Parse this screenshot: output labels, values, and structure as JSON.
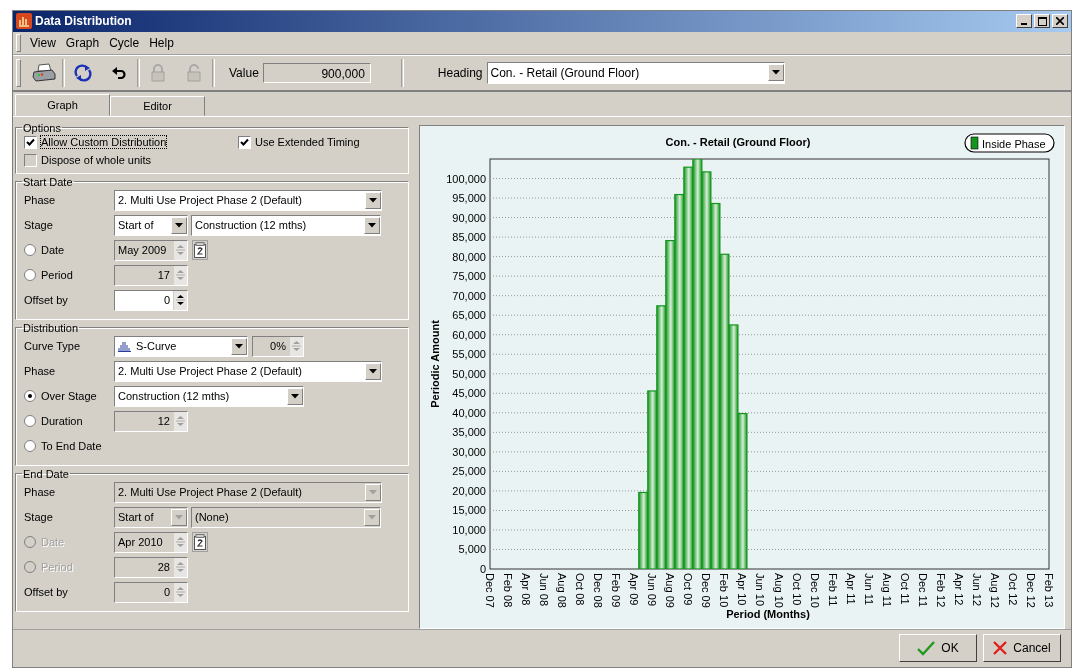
{
  "window": {
    "title": "Data Distribution"
  },
  "menu": [
    {
      "label": "View"
    },
    {
      "label": "Graph"
    },
    {
      "label": "Cycle"
    },
    {
      "label": "Help"
    }
  ],
  "toolbar": {
    "buttons": [
      {
        "kind": "print",
        "disabled": false
      },
      {
        "kind": "refresh",
        "disabled": false
      },
      {
        "kind": "undo",
        "disabled": false
      },
      {
        "kind": "lock",
        "disabled": true
      },
      {
        "kind": "unlock",
        "disabled": true
      }
    ],
    "value_label": "Value",
    "value": "900,000",
    "heading_label": "Heading",
    "heading": "Con. - Retail (Ground Floor)"
  },
  "tabs": [
    {
      "label": "Graph",
      "selected": true
    },
    {
      "label": "Editor",
      "selected": false
    }
  ],
  "options": {
    "title": "Options",
    "checks": [
      {
        "label": "Allow Custom Distribution",
        "checked": true,
        "disabled": false
      },
      {
        "label": "Use Extended Timing",
        "checked": true,
        "disabled": false
      },
      {
        "label": "Dispose of whole units",
        "checked": false,
        "disabled": true
      }
    ]
  },
  "sections": [
    {
      "title": "Start Date",
      "rows": [
        {
          "kind": "combo",
          "label": "Phase",
          "value": "2. Multi Use Project Phase 2  (Default)",
          "disabled": false
        },
        {
          "kind": "stage",
          "label": "Stage",
          "qualifier": "Start of",
          "value": "Construction (12 mths)",
          "disabled": false
        },
        {
          "kind": "date",
          "label": "Date",
          "selected": false,
          "label_disabled": false,
          "value": "May 2009",
          "disabled": true
        },
        {
          "kind": "spin",
          "label": "Period",
          "selected": false,
          "label_disabled": false,
          "value": "17",
          "disabled": true
        },
        {
          "kind": "spin",
          "label": "Offset by",
          "value": "0",
          "disabled": false
        }
      ]
    },
    {
      "title": "Distribution",
      "rows": [
        {
          "kind": "curve",
          "label": "Curve Type",
          "value": "S-Curve",
          "percent": "0%",
          "disabled": false,
          "percent_disabled": true
        },
        {
          "kind": "combo",
          "label": "Phase",
          "value": "2. Multi Use Project Phase 2  (Default)",
          "disabled": false
        },
        {
          "kind": "short-combo",
          "label": "Over Stage",
          "selected": true,
          "label_disabled": false,
          "value": "Construction (12 mths)",
          "disabled": false
        },
        {
          "kind": "spin",
          "label": "Duration",
          "selected": false,
          "label_disabled": false,
          "value": "12",
          "disabled": true
        },
        {
          "kind": "none",
          "label": "To End Date",
          "selected": false,
          "label_disabled": false
        }
      ]
    },
    {
      "title": "End Date",
      "rows": [
        {
          "kind": "combo",
          "label": "Phase",
          "value": "2. Multi Use Project Phase 2  (Default)",
          "disabled": true
        },
        {
          "kind": "stage",
          "label": "Stage",
          "qualifier": "Start of",
          "value": "(None)",
          "disabled": true
        },
        {
          "kind": "date",
          "label": "Date",
          "selected": false,
          "label_disabled": true,
          "value": "Apr 2010",
          "disabled": true
        },
        {
          "kind": "spin",
          "label": "Period",
          "selected": false,
          "label_disabled": true,
          "value": "28",
          "disabled": true
        },
        {
          "kind": "spin",
          "label": "Offset by",
          "value": "0",
          "disabled": true
        }
      ]
    }
  ],
  "graph": {
    "chart_data": {
      "type": "bar",
      "title": "Con. - Retail (Ground Floor)",
      "xlabel": "Period (Months)",
      "ylabel": "Periodic Amount",
      "categories": [
        "Dec 07",
        null,
        "Feb 08",
        null,
        "Apr 08",
        null,
        "Jun 08",
        null,
        "Aug 08",
        null,
        "Oct 08",
        null,
        "Dec 08",
        null,
        "Feb 09",
        null,
        "Apr 09",
        null,
        "Jun 09",
        null,
        "Aug 09",
        null,
        "Oct 09",
        null,
        "Dec 09",
        null,
        "Feb 10",
        null,
        "Apr 10",
        null,
        "Jun 10",
        null,
        "Aug 10",
        null,
        "Oct 10",
        null,
        "Dec 10",
        null,
        "Feb 11",
        null,
        "Apr 11",
        null,
        "Jun 11",
        null,
        "Aug 11",
        null,
        "Oct 11",
        null,
        "Dec 11",
        null,
        "Feb 12",
        null,
        "Apr 12",
        null,
        "Jun 12",
        null,
        "Aug 12",
        null,
        "Oct 12",
        null,
        "Dec 12",
        null,
        "Feb 13"
      ],
      "series": [
        {
          "name": "Inside Phase",
          "color": "#14961e",
          "values": [
            null,
            null,
            null,
            null,
            null,
            null,
            null,
            null,
            null,
            null,
            null,
            null,
            null,
            null,
            null,
            null,
            null,
            19600,
            45600,
            67400,
            84100,
            95900,
            102900,
            105000,
            101700,
            93600,
            80600,
            62500,
            39800,
            null,
            null,
            null,
            null,
            null,
            null,
            null,
            null,
            null,
            null,
            null,
            null,
            null,
            null,
            null,
            null,
            null,
            null,
            null,
            null,
            null,
            null,
            null,
            null,
            null,
            null,
            null,
            null,
            null,
            null,
            null,
            null,
            null,
            null
          ]
        }
      ],
      "ylim": [
        0,
        105000
      ],
      "grid": true,
      "yticks": [
        0,
        {
          "value": 5000,
          "label": "5,000"
        },
        {
          "value": 10000,
          "label": "10,000"
        },
        {
          "value": 15000,
          "label": "15,000"
        },
        {
          "value": 20000,
          "label": "20,000"
        },
        {
          "value": 25000,
          "label": "25,000"
        },
        {
          "value": 30000,
          "label": "30,000"
        },
        {
          "value": 35000,
          "label": "35,000"
        },
        {
          "value": 40000,
          "label": "40,000"
        },
        {
          "value": 45000,
          "label": "45,000"
        },
        {
          "value": 50000,
          "label": "50,000"
        },
        {
          "value": 55000,
          "label": "55,000"
        },
        {
          "value": 60000,
          "label": "60,000"
        },
        {
          "value": 65000,
          "label": "65,000"
        },
        {
          "value": 70000,
          "label": "70,000"
        },
        {
          "value": 75000,
          "label": "75,000"
        },
        {
          "value": 80000,
          "label": "80,000"
        },
        {
          "value": 85000,
          "label": "85,000"
        },
        {
          "value": 90000,
          "label": "90,000"
        },
        {
          "value": 95000,
          "label": "95,000"
        },
        {
          "value": 100000,
          "label": "100,000"
        }
      ]
    }
  },
  "footer": {
    "buttons": [
      {
        "kind": "ok",
        "label": "OK"
      },
      {
        "kind": "cancel",
        "label": "Cancel"
      }
    ]
  }
}
